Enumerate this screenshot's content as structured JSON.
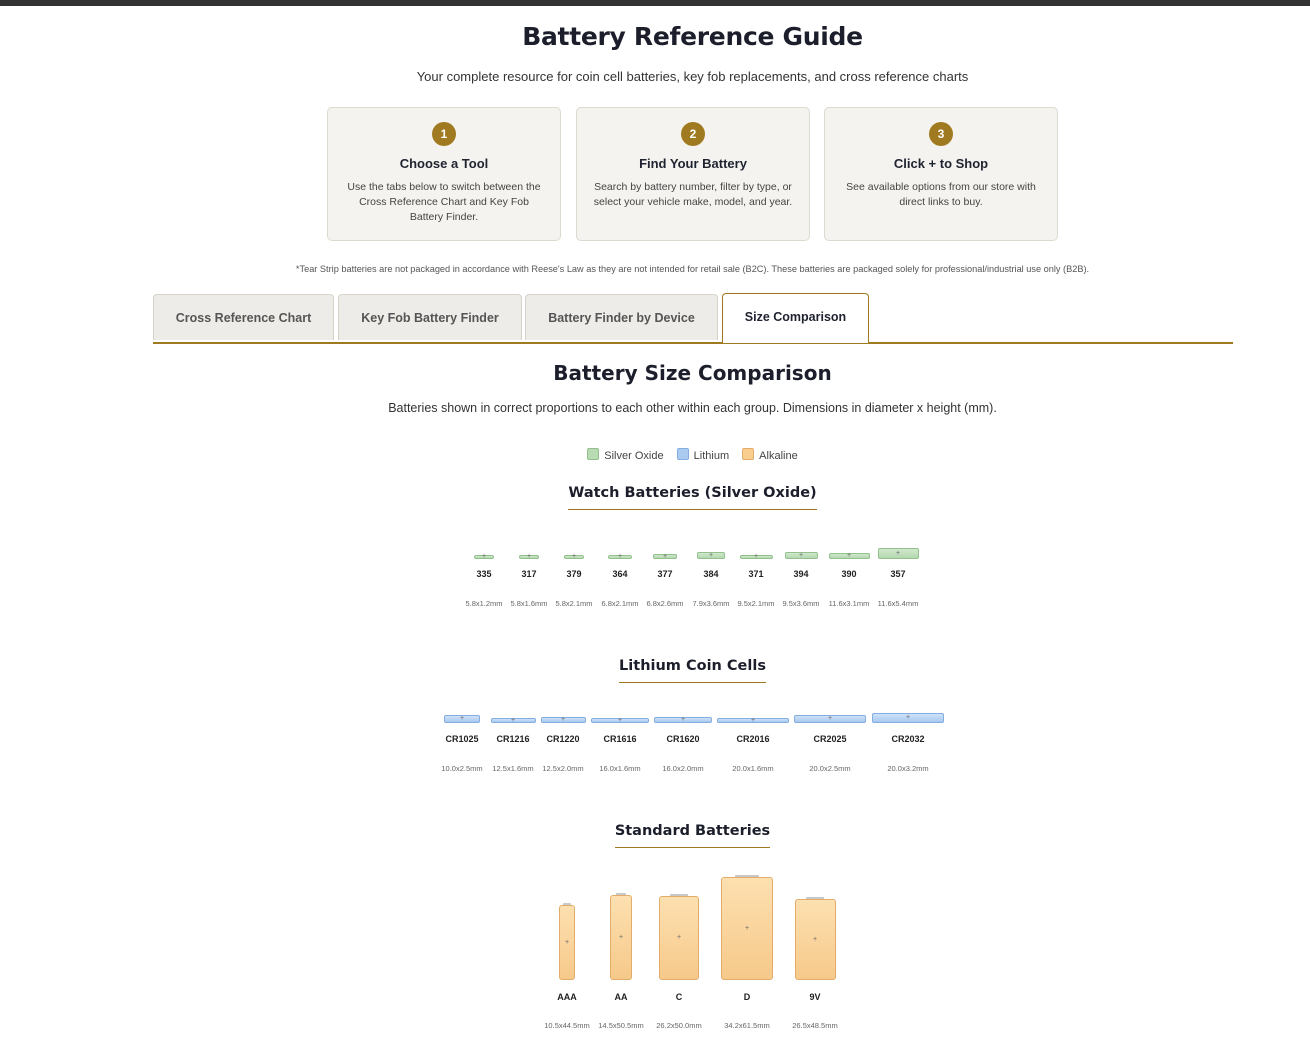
{
  "header": {
    "title": "Battery Reference Guide",
    "subtitle": "Your complete resource for coin cell batteries, key fob replacements, and cross reference charts"
  },
  "steps": [
    {
      "num": "1",
      "title": "Choose a Tool",
      "desc": "Use the tabs below to switch between the Cross Reference Chart and Key Fob Battery Finder."
    },
    {
      "num": "2",
      "title": "Find Your Battery",
      "desc": "Search by battery number, filter by type, or select your vehicle make, model, and year."
    },
    {
      "num": "3",
      "title": "Click + to Shop",
      "desc": "See available options from our store with direct links to buy."
    }
  ],
  "disclaimer": "*Tear Strip batteries are not packaged in accordance with Reese's Law as they are not intended for retail sale (B2C). These batteries are packaged solely for professional/industrial use only (B2B).",
  "tabs": [
    {
      "label": "Cross Reference Chart",
      "active": false
    },
    {
      "label": "Key Fob Battery Finder",
      "active": false
    },
    {
      "label": "Battery Finder by Device",
      "active": false
    },
    {
      "label": "Size Comparison",
      "active": true
    }
  ],
  "size_comparison": {
    "title": "Battery Size Comparison",
    "description": "Batteries shown in correct proportions to each other within each group. Dimensions in diameter x height (mm).",
    "legend": [
      {
        "label": "Silver Oxide",
        "color": "#b8dbb4"
      },
      {
        "label": "Lithium",
        "color": "#abcaf0"
      },
      {
        "label": "Alkaline",
        "color": "#f8cd8e"
      }
    ],
    "plus_symbol": "+",
    "groups": [
      {
        "title": "Watch Batteries (Silver Oxide)",
        "kind": "silver",
        "batteries": [
          {
            "name": "335",
            "dims": "5.8x1.2mm",
            "diameter": 5.8,
            "height": 1.2
          },
          {
            "name": "317",
            "dims": "5.8x1.6mm",
            "diameter": 5.8,
            "height": 1.6
          },
          {
            "name": "379",
            "dims": "5.8x2.1mm",
            "diameter": 5.8,
            "height": 2.1
          },
          {
            "name": "364",
            "dims": "6.8x2.1mm",
            "diameter": 6.8,
            "height": 2.1
          },
          {
            "name": "377",
            "dims": "6.8x2.6mm",
            "diameter": 6.8,
            "height": 2.6
          },
          {
            "name": "384",
            "dims": "7.9x3.6mm",
            "diameter": 7.9,
            "height": 3.6
          },
          {
            "name": "371",
            "dims": "9.5x2.1mm",
            "diameter": 9.5,
            "height": 2.1
          },
          {
            "name": "394",
            "dims": "9.5x3.6mm",
            "diameter": 9.5,
            "height": 3.6
          },
          {
            "name": "390",
            "dims": "11.6x3.1mm",
            "diameter": 11.6,
            "height": 3.1
          },
          {
            "name": "357",
            "dims": "11.6x5.4mm",
            "diameter": 11.6,
            "height": 5.4
          }
        ]
      },
      {
        "title": "Lithium Coin Cells",
        "kind": "lithium",
        "batteries": [
          {
            "name": "CR1025",
            "dims": "10.0x2.5mm",
            "diameter": 10.0,
            "height": 2.5
          },
          {
            "name": "CR1216",
            "dims": "12.5x1.6mm",
            "diameter": 12.5,
            "height": 1.6
          },
          {
            "name": "CR1220",
            "dims": "12.5x2.0mm",
            "diameter": 12.5,
            "height": 2.0
          },
          {
            "name": "CR1616",
            "dims": "16.0x1.6mm",
            "diameter": 16.0,
            "height": 1.6
          },
          {
            "name": "CR1620",
            "dims": "16.0x2.0mm",
            "diameter": 16.0,
            "height": 2.0
          },
          {
            "name": "CR2016",
            "dims": "20.0x1.6mm",
            "diameter": 20.0,
            "height": 1.6
          },
          {
            "name": "CR2025",
            "dims": "20.0x2.5mm",
            "diameter": 20.0,
            "height": 2.5
          },
          {
            "name": "CR2032",
            "dims": "20.0x3.2mm",
            "diameter": 20.0,
            "height": 3.2
          }
        ]
      },
      {
        "title": "Standard Batteries",
        "kind": "alkaline",
        "batteries": [
          {
            "name": "AAA",
            "dims": "10.5x44.5mm",
            "diameter": 10.5,
            "height": 44.5
          },
          {
            "name": "AA",
            "dims": "14.5x50.5mm",
            "diameter": 14.5,
            "height": 50.5
          },
          {
            "name": "C",
            "dims": "26.2x50.0mm",
            "diameter": 26.2,
            "height": 50.0
          },
          {
            "name": "D",
            "dims": "34.2x61.5mm",
            "diameter": 34.2,
            "height": 61.5
          },
          {
            "name": "9V",
            "dims": "26.5x48.5mm",
            "diameter": 26.5,
            "height": 48.5
          }
        ]
      }
    ]
  }
}
